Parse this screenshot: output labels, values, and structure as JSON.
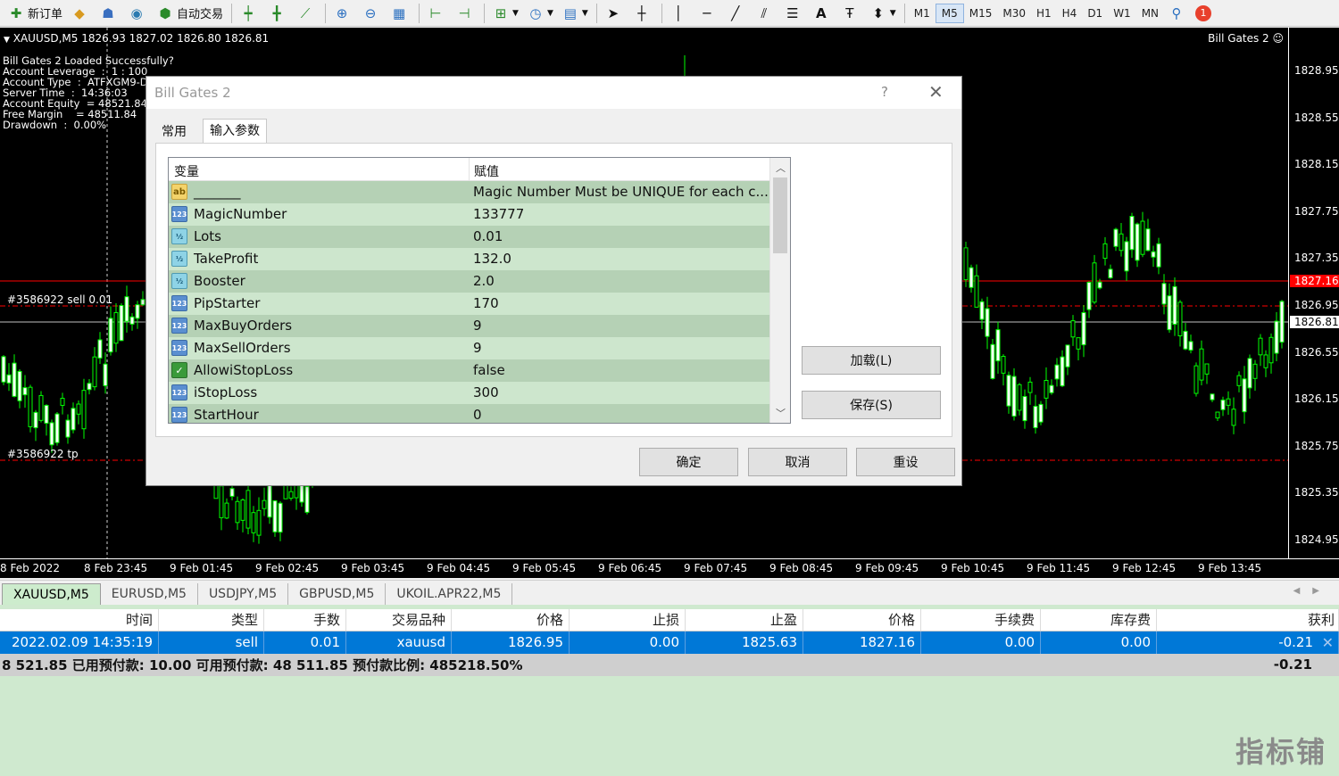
{
  "toolbar": {
    "new_order": "新订单",
    "auto_trading": "自动交易",
    "timeframes": [
      "M1",
      "M5",
      "M15",
      "M30",
      "H1",
      "H4",
      "D1",
      "W1",
      "MN"
    ],
    "active_timeframe": "M5",
    "notification_count": "1"
  },
  "chart": {
    "title": "XAUUSD,M5  1826.93 1827.02 1826.80 1826.81",
    "ea_name": "Bill Gates 2 ☺",
    "info_lines": [
      "Bill Gates 2 Loaded Successfully?",
      "Account Leverage  :  1 : 100",
      "Account Type  :  ATFXGM9-D",
      "Server Time  :  14:36:03",
      "Account Equity  = 48521.84",
      "Free Margin    = 48511.84",
      "Drawdown  :  0.00%"
    ],
    "order_sell_label": "#3586922 sell 0.01",
    "order_tp_label": "#3586922 tp",
    "price_labels": [
      "1828.95",
      "1828.55",
      "1828.15",
      "1827.75",
      "1827.35",
      "1826.95",
      "1826.55",
      "1826.15",
      "1825.75",
      "1825.35",
      "1824.95"
    ],
    "price_tag_red": "1827.16",
    "price_tag_current": "1826.81",
    "time_labels": [
      "8 Feb 2022",
      "8 Feb 23:45",
      "9 Feb 01:45",
      "9 Feb 02:45",
      "9 Feb 03:45",
      "9 Feb 04:45",
      "9 Feb 05:45",
      "9 Feb 06:45",
      "9 Feb 07:45",
      "9 Feb 08:45",
      "9 Feb 09:45",
      "9 Feb 10:45",
      "9 Feb 11:45",
      "9 Feb 12:45",
      "9 Feb 13:45"
    ],
    "colors": {
      "background": "#000000",
      "candle": "#00ff00",
      "sell_line": "#ff0000",
      "bid_line": "#c0c0c0"
    }
  },
  "symbol_tabs": [
    "XAUUSD,M5",
    "EURUSD,M5",
    "USDJPY,M5",
    "GBPUSD,M5",
    "UKOIL.APR22,M5"
  ],
  "terminal": {
    "headers": [
      "时间",
      "类型",
      "手数",
      "交易品种",
      "价格",
      "止损",
      "止盈",
      "价格",
      "手续费",
      "库存费",
      "获利"
    ],
    "row": [
      "2022.02.09 14:35:19",
      "sell",
      "0.01",
      "xauusd",
      "1826.95",
      "0.00",
      "1825.63",
      "1827.16",
      "0.00",
      "0.00",
      "-0.21"
    ],
    "summary": "8 521.85  已用预付款: 10.00  可用预付款: 48 511.85  预付款比例: 485218.50%",
    "summary_profit": "-0.21"
  },
  "watermark": "指标铺",
  "dialog": {
    "title": "Bill Gates 2",
    "help": "?",
    "tabs": [
      "常用",
      "输入参数"
    ],
    "active_tab": "输入参数",
    "columns": [
      "变量",
      "赋值"
    ],
    "params": [
      {
        "icon": "ab",
        "type": "string",
        "name": "_______",
        "value": "Magic Number Must be UNIQUE for each c..."
      },
      {
        "icon": "123",
        "type": "int",
        "name": "MagicNumber",
        "value": "133777"
      },
      {
        "icon": "½",
        "type": "double",
        "name": "Lots",
        "value": "0.01"
      },
      {
        "icon": "½",
        "type": "double",
        "name": "TakeProfit",
        "value": "132.0"
      },
      {
        "icon": "½",
        "type": "double",
        "name": "Booster",
        "value": "2.0"
      },
      {
        "icon": "123",
        "type": "int",
        "name": "PipStarter",
        "value": "170"
      },
      {
        "icon": "123",
        "type": "int",
        "name": "MaxBuyOrders",
        "value": "9"
      },
      {
        "icon": "123",
        "type": "int",
        "name": "MaxSellOrders",
        "value": "9"
      },
      {
        "icon": "✓",
        "type": "bool",
        "name": "AllowiStopLoss",
        "value": "false"
      },
      {
        "icon": "123",
        "type": "int",
        "name": "iStopLoss",
        "value": "300"
      },
      {
        "icon": "123",
        "type": "int",
        "name": "StartHour",
        "value": "0"
      }
    ],
    "load_button": "加载(L)",
    "save_button": "保存(S)",
    "ok_button": "确定",
    "cancel_button": "取消",
    "reset_button": "重设"
  }
}
